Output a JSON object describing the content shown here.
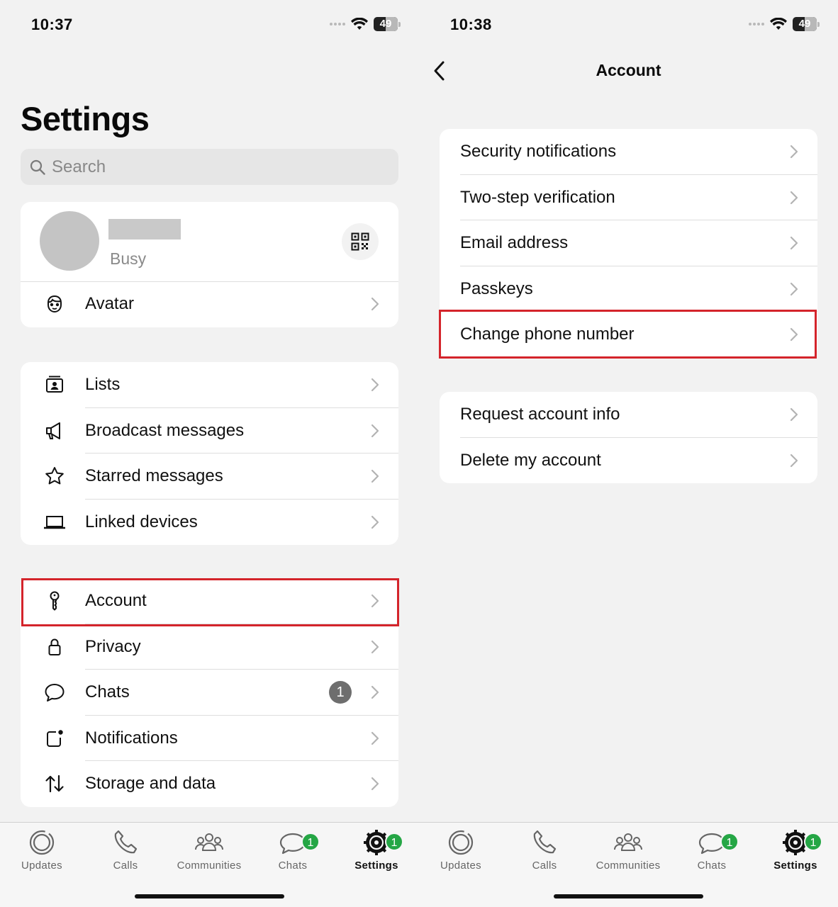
{
  "left": {
    "status": {
      "time": "10:37",
      "battery": "49"
    },
    "title": "Settings",
    "search": {
      "placeholder": "Search"
    },
    "profile": {
      "status": "Busy"
    },
    "group1": [
      {
        "label": "Avatar",
        "icon": "avatar-face-icon"
      }
    ],
    "group2": [
      {
        "label": "Lists",
        "icon": "lists-icon"
      },
      {
        "label": "Broadcast messages",
        "icon": "megaphone-icon"
      },
      {
        "label": "Starred messages",
        "icon": "star-icon"
      },
      {
        "label": "Linked devices",
        "icon": "laptop-icon"
      }
    ],
    "group3": [
      {
        "label": "Account",
        "icon": "key-icon"
      },
      {
        "label": "Privacy",
        "icon": "lock-icon"
      },
      {
        "label": "Chats",
        "icon": "chat-bubble-icon",
        "count": "1"
      },
      {
        "label": "Notifications",
        "icon": "notification-icon"
      },
      {
        "label": "Storage and data",
        "icon": "up-down-arrows-icon"
      }
    ]
  },
  "right": {
    "status": {
      "time": "10:38",
      "battery": "49"
    },
    "title": "Account",
    "group1": [
      {
        "label": "Security notifications"
      },
      {
        "label": "Two-step verification"
      },
      {
        "label": "Email address"
      },
      {
        "label": "Passkeys"
      },
      {
        "label": "Change phone number"
      }
    ],
    "group2": [
      {
        "label": "Request account info"
      },
      {
        "label": "Delete my account"
      }
    ]
  },
  "tabbar": {
    "tabs": [
      {
        "label": "Updates",
        "icon": "updates-icon"
      },
      {
        "label": "Calls",
        "icon": "phone-icon"
      },
      {
        "label": "Communities",
        "icon": "communities-icon"
      },
      {
        "label": "Chats",
        "icon": "chats-icon",
        "badge": "1"
      },
      {
        "label": "Settings",
        "icon": "gear-icon",
        "badge": "1",
        "active": true
      }
    ]
  },
  "colors": {
    "highlight": "#d4242b",
    "badge_green": "#25a645",
    "count_gray": "#6e6e6e"
  }
}
